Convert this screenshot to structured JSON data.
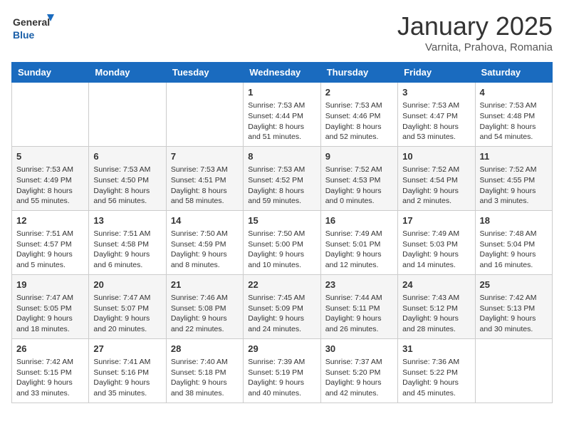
{
  "header": {
    "logo_general": "General",
    "logo_blue": "Blue",
    "title": "January 2025",
    "subtitle": "Varnita, Prahova, Romania"
  },
  "columns": [
    "Sunday",
    "Monday",
    "Tuesday",
    "Wednesday",
    "Thursday",
    "Friday",
    "Saturday"
  ],
  "weeks": [
    [
      {
        "day": "",
        "info": ""
      },
      {
        "day": "",
        "info": ""
      },
      {
        "day": "",
        "info": ""
      },
      {
        "day": "1",
        "info": "Sunrise: 7:53 AM\nSunset: 4:44 PM\nDaylight: 8 hours\nand 51 minutes."
      },
      {
        "day": "2",
        "info": "Sunrise: 7:53 AM\nSunset: 4:46 PM\nDaylight: 8 hours\nand 52 minutes."
      },
      {
        "day": "3",
        "info": "Sunrise: 7:53 AM\nSunset: 4:47 PM\nDaylight: 8 hours\nand 53 minutes."
      },
      {
        "day": "4",
        "info": "Sunrise: 7:53 AM\nSunset: 4:48 PM\nDaylight: 8 hours\nand 54 minutes."
      }
    ],
    [
      {
        "day": "5",
        "info": "Sunrise: 7:53 AM\nSunset: 4:49 PM\nDaylight: 8 hours\nand 55 minutes."
      },
      {
        "day": "6",
        "info": "Sunrise: 7:53 AM\nSunset: 4:50 PM\nDaylight: 8 hours\nand 56 minutes."
      },
      {
        "day": "7",
        "info": "Sunrise: 7:53 AM\nSunset: 4:51 PM\nDaylight: 8 hours\nand 58 minutes."
      },
      {
        "day": "8",
        "info": "Sunrise: 7:53 AM\nSunset: 4:52 PM\nDaylight: 8 hours\nand 59 minutes."
      },
      {
        "day": "9",
        "info": "Sunrise: 7:52 AM\nSunset: 4:53 PM\nDaylight: 9 hours\nand 0 minutes."
      },
      {
        "day": "10",
        "info": "Sunrise: 7:52 AM\nSunset: 4:54 PM\nDaylight: 9 hours\nand 2 minutes."
      },
      {
        "day": "11",
        "info": "Sunrise: 7:52 AM\nSunset: 4:55 PM\nDaylight: 9 hours\nand 3 minutes."
      }
    ],
    [
      {
        "day": "12",
        "info": "Sunrise: 7:51 AM\nSunset: 4:57 PM\nDaylight: 9 hours\nand 5 minutes."
      },
      {
        "day": "13",
        "info": "Sunrise: 7:51 AM\nSunset: 4:58 PM\nDaylight: 9 hours\nand 6 minutes."
      },
      {
        "day": "14",
        "info": "Sunrise: 7:50 AM\nSunset: 4:59 PM\nDaylight: 9 hours\nand 8 minutes."
      },
      {
        "day": "15",
        "info": "Sunrise: 7:50 AM\nSunset: 5:00 PM\nDaylight: 9 hours\nand 10 minutes."
      },
      {
        "day": "16",
        "info": "Sunrise: 7:49 AM\nSunset: 5:01 PM\nDaylight: 9 hours\nand 12 minutes."
      },
      {
        "day": "17",
        "info": "Sunrise: 7:49 AM\nSunset: 5:03 PM\nDaylight: 9 hours\nand 14 minutes."
      },
      {
        "day": "18",
        "info": "Sunrise: 7:48 AM\nSunset: 5:04 PM\nDaylight: 9 hours\nand 16 minutes."
      }
    ],
    [
      {
        "day": "19",
        "info": "Sunrise: 7:47 AM\nSunset: 5:05 PM\nDaylight: 9 hours\nand 18 minutes."
      },
      {
        "day": "20",
        "info": "Sunrise: 7:47 AM\nSunset: 5:07 PM\nDaylight: 9 hours\nand 20 minutes."
      },
      {
        "day": "21",
        "info": "Sunrise: 7:46 AM\nSunset: 5:08 PM\nDaylight: 9 hours\nand 22 minutes."
      },
      {
        "day": "22",
        "info": "Sunrise: 7:45 AM\nSunset: 5:09 PM\nDaylight: 9 hours\nand 24 minutes."
      },
      {
        "day": "23",
        "info": "Sunrise: 7:44 AM\nSunset: 5:11 PM\nDaylight: 9 hours\nand 26 minutes."
      },
      {
        "day": "24",
        "info": "Sunrise: 7:43 AM\nSunset: 5:12 PM\nDaylight: 9 hours\nand 28 minutes."
      },
      {
        "day": "25",
        "info": "Sunrise: 7:42 AM\nSunset: 5:13 PM\nDaylight: 9 hours\nand 30 minutes."
      }
    ],
    [
      {
        "day": "26",
        "info": "Sunrise: 7:42 AM\nSunset: 5:15 PM\nDaylight: 9 hours\nand 33 minutes."
      },
      {
        "day": "27",
        "info": "Sunrise: 7:41 AM\nSunset: 5:16 PM\nDaylight: 9 hours\nand 35 minutes."
      },
      {
        "day": "28",
        "info": "Sunrise: 7:40 AM\nSunset: 5:18 PM\nDaylight: 9 hours\nand 38 minutes."
      },
      {
        "day": "29",
        "info": "Sunrise: 7:39 AM\nSunset: 5:19 PM\nDaylight: 9 hours\nand 40 minutes."
      },
      {
        "day": "30",
        "info": "Sunrise: 7:37 AM\nSunset: 5:20 PM\nDaylight: 9 hours\nand 42 minutes."
      },
      {
        "day": "31",
        "info": "Sunrise: 7:36 AM\nSunset: 5:22 PM\nDaylight: 9 hours\nand 45 minutes."
      },
      {
        "day": "",
        "info": ""
      }
    ]
  ]
}
